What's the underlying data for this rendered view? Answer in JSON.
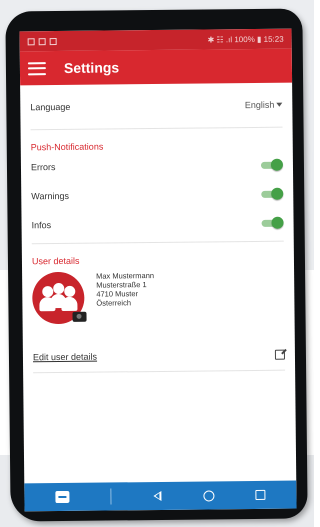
{
  "statusbar": {
    "right_text": "✱ ☷ .ıl 100% ▮ 15:23"
  },
  "appbar": {
    "title": "Settings"
  },
  "language": {
    "label": "Language",
    "value": "English"
  },
  "push": {
    "section_title": "Push-Notifications",
    "items": [
      {
        "label": "Errors",
        "enabled": true
      },
      {
        "label": "Warnings",
        "enabled": true
      },
      {
        "label": "Infos",
        "enabled": true
      }
    ]
  },
  "user": {
    "section_title": "User details",
    "address_lines": [
      "Max Mustermann",
      "Musterstraße 1",
      "4710 Muster",
      "Österreich"
    ],
    "edit_label": "Edit user details"
  },
  "icons": {
    "menu": "menu-icon",
    "dropdown": "caret-down-icon",
    "edit": "external-edit-icon",
    "camera": "camera-icon",
    "avatar": "group-avatar-icon"
  },
  "colors": {
    "primary_red": "#d8282f",
    "toggle_green": "#45a047",
    "navbar_blue": "#1e78c2"
  }
}
